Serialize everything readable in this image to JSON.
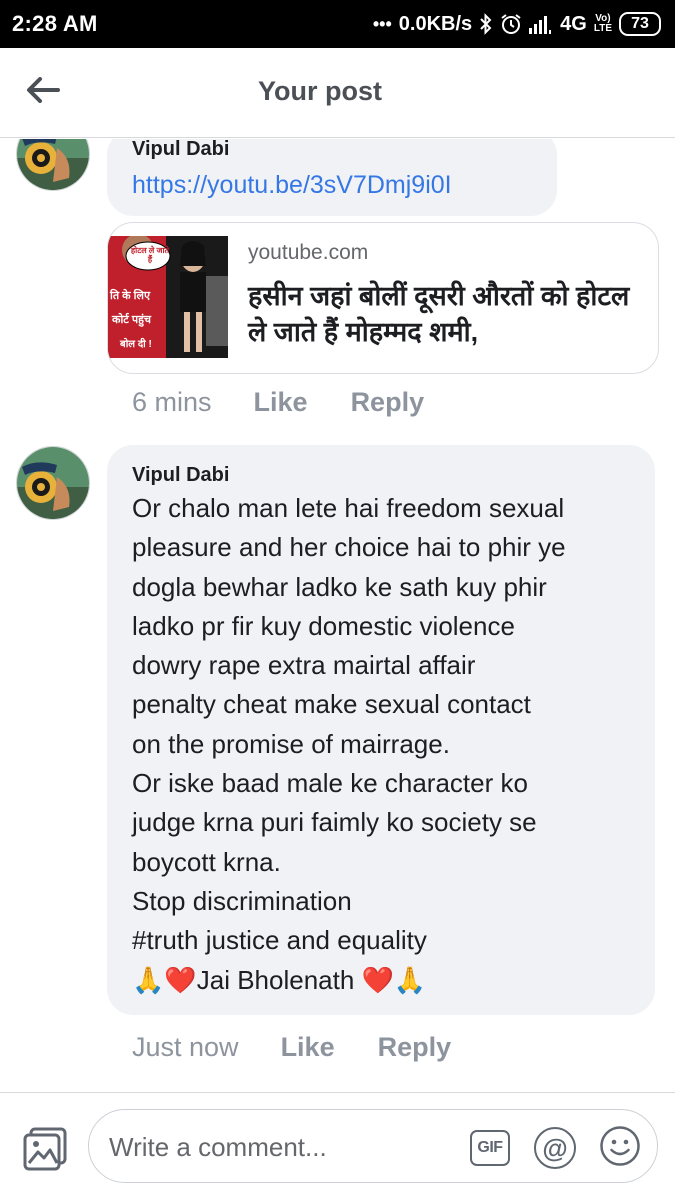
{
  "status_bar": {
    "time": "2:28 AM",
    "dots": "•••",
    "network_speed": "0.0KB/s",
    "network_type": "4G",
    "volte_line1": "Vo)",
    "volte_line2": "LTE",
    "battery": "73",
    "icons": [
      "bluetooth-icon",
      "alarm-icon",
      "signal-icon",
      "volte-icon",
      "battery-icon"
    ]
  },
  "header": {
    "title": "Your post",
    "back_icon": "arrow-left-icon"
  },
  "comments": [
    {
      "author": "Vipul Dabi",
      "link": "https://youtu.be/3sV7Dmj9i0I",
      "link_preview": {
        "domain": "youtube.com",
        "title": "हसीन जहां बोलीं दूसरी औरतों को होटल ले जाते हैं मोहम्मद शमी,",
        "thumb_text": [
          "ति के लिए",
          "कोर्ट पहुंच",
          "बोल दी !"
        ],
        "thumb_bubble": "होटल ले जाते हैं"
      },
      "time": "6 mins",
      "like_label": "Like",
      "reply_label": "Reply"
    },
    {
      "author": "Vipul Dabi",
      "body_lines": [
        "Or chalo man lete hai freedom sexual",
        "pleasure and her choice hai to phir ye",
        "dogla bewhar ladko ke sath kuy phir",
        "ladko pr fir kuy domestic violence",
        "dowry rape extra mairtal affair",
        "penalty cheat make sexual contact",
        "on the  promise of mairrage.",
        "Or iske baad male ke character ko",
        "judge krna puri faimly ko society se",
        "boycott krna.",
        "Stop discrimination",
        "#truth justice and equality",
        "🙏❤️Jai Bholenath ❤️🙏"
      ],
      "time": "Just now",
      "like_label": "Like",
      "reply_label": "Reply"
    }
  ],
  "composer": {
    "placeholder": "Write a comment...",
    "gif_label": "GIF",
    "mention_label": "@",
    "icons": [
      "photo-icon",
      "gif-icon",
      "mention-icon",
      "emoji-icon"
    ]
  },
  "colors": {
    "link": "#3578e5",
    "bubble": "#f0f2f5",
    "muted": "#8d949e",
    "heart": "#e0245e"
  }
}
